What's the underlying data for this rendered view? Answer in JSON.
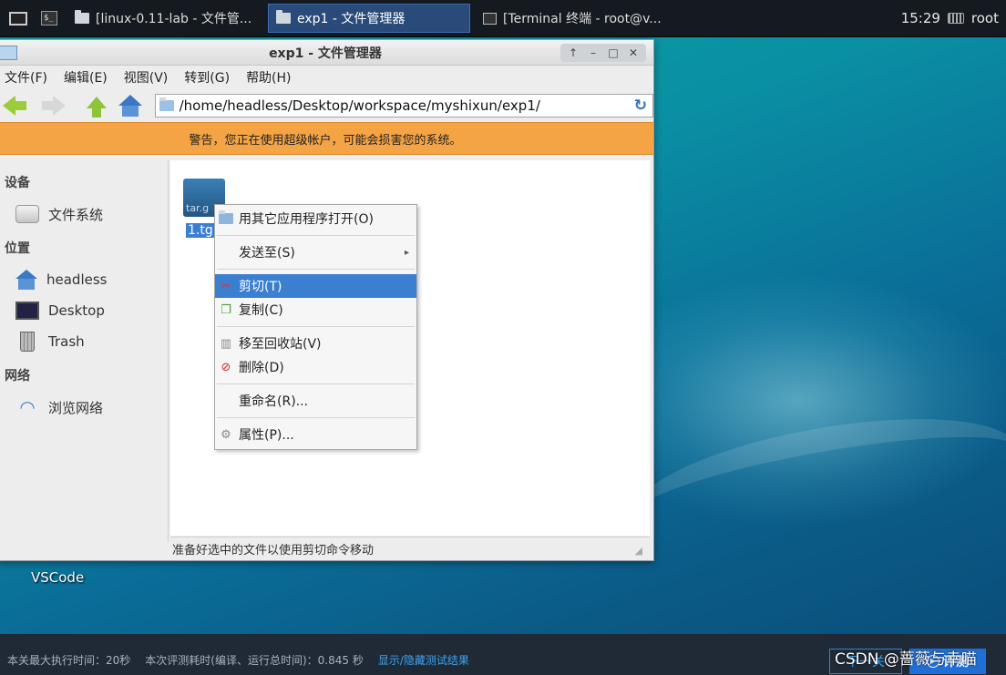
{
  "taskbar": {
    "tasks": [
      {
        "label": "[linux-0.11-lab - 文件管..."
      },
      {
        "label": "exp1 - 文件管理器"
      },
      {
        "label": "[Terminal 终端 - root@v..."
      }
    ],
    "clock": "15:29",
    "user": "root"
  },
  "window": {
    "title": "exp1 - 文件管理器",
    "controls": {
      "up": "↑",
      "minimize": "–",
      "maximize": "□",
      "close": "✕"
    }
  },
  "menubar": [
    "文件(F)",
    "编辑(E)",
    "视图(V)",
    "转到(G)",
    "帮助(H)"
  ],
  "pathbar": {
    "value": "/home/headless/Desktop/workspace/myshixun/exp1/",
    "reload_glyph": "↻"
  },
  "warning": "警告，您正在使用超级帐户，可能会损害您的系统。",
  "sidebar": {
    "devices_header": "设备",
    "devices": [
      {
        "label": "文件系统"
      }
    ],
    "places_header": "位置",
    "places": [
      {
        "label": "headless"
      },
      {
        "label": "Desktop"
      },
      {
        "label": "Trash"
      }
    ],
    "network_header": "网络",
    "network": [
      {
        "label": "浏览网络"
      }
    ]
  },
  "file": {
    "name": "1.tg",
    "icon_text": "tar.g"
  },
  "context_menu": {
    "open_with": "用其它应用程序打开(O)",
    "send_to": "发送至(S)",
    "cut": "剪切(T)",
    "copy": "复制(C)",
    "trash": "移至回收站(V)",
    "delete": "删除(D)",
    "rename": "重命名(R)...",
    "properties": "属性(P)..."
  },
  "statusbar": "准备好选中的文件以使用剪切命令移动",
  "desktop": {
    "vscode_label": "VSCode"
  },
  "bottombar": {
    "max_time": "本关最大执行时间：20秒",
    "eval_time": "本次评测耗时(编译、运行总时间)：0.845 秒",
    "toggle_link": "显示/隐藏测试结果",
    "next_btn": "下一关",
    "eval_btn": "评测"
  },
  "watermark": "CSDN @蔷薇与幸喵"
}
